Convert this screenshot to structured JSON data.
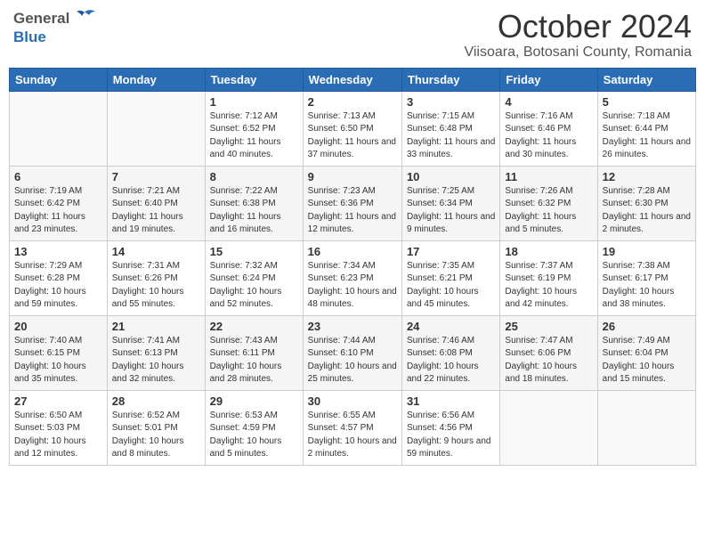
{
  "header": {
    "logo": {
      "general_text": "General",
      "blue_text": "Blue"
    },
    "month": "October 2024",
    "location": "Viisoara, Botosani County, Romania"
  },
  "weekdays": [
    "Sunday",
    "Monday",
    "Tuesday",
    "Wednesday",
    "Thursday",
    "Friday",
    "Saturday"
  ],
  "weeks": [
    [
      {
        "day": "",
        "info": ""
      },
      {
        "day": "",
        "info": ""
      },
      {
        "day": "1",
        "info": "Sunrise: 7:12 AM\nSunset: 6:52 PM\nDaylight: 11 hours and 40 minutes."
      },
      {
        "day": "2",
        "info": "Sunrise: 7:13 AM\nSunset: 6:50 PM\nDaylight: 11 hours and 37 minutes."
      },
      {
        "day": "3",
        "info": "Sunrise: 7:15 AM\nSunset: 6:48 PM\nDaylight: 11 hours and 33 minutes."
      },
      {
        "day": "4",
        "info": "Sunrise: 7:16 AM\nSunset: 6:46 PM\nDaylight: 11 hours and 30 minutes."
      },
      {
        "day": "5",
        "info": "Sunrise: 7:18 AM\nSunset: 6:44 PM\nDaylight: 11 hours and 26 minutes."
      }
    ],
    [
      {
        "day": "6",
        "info": "Sunrise: 7:19 AM\nSunset: 6:42 PM\nDaylight: 11 hours and 23 minutes."
      },
      {
        "day": "7",
        "info": "Sunrise: 7:21 AM\nSunset: 6:40 PM\nDaylight: 11 hours and 19 minutes."
      },
      {
        "day": "8",
        "info": "Sunrise: 7:22 AM\nSunset: 6:38 PM\nDaylight: 11 hours and 16 minutes."
      },
      {
        "day": "9",
        "info": "Sunrise: 7:23 AM\nSunset: 6:36 PM\nDaylight: 11 hours and 12 minutes."
      },
      {
        "day": "10",
        "info": "Sunrise: 7:25 AM\nSunset: 6:34 PM\nDaylight: 11 hours and 9 minutes."
      },
      {
        "day": "11",
        "info": "Sunrise: 7:26 AM\nSunset: 6:32 PM\nDaylight: 11 hours and 5 minutes."
      },
      {
        "day": "12",
        "info": "Sunrise: 7:28 AM\nSunset: 6:30 PM\nDaylight: 11 hours and 2 minutes."
      }
    ],
    [
      {
        "day": "13",
        "info": "Sunrise: 7:29 AM\nSunset: 6:28 PM\nDaylight: 10 hours and 59 minutes."
      },
      {
        "day": "14",
        "info": "Sunrise: 7:31 AM\nSunset: 6:26 PM\nDaylight: 10 hours and 55 minutes."
      },
      {
        "day": "15",
        "info": "Sunrise: 7:32 AM\nSunset: 6:24 PM\nDaylight: 10 hours and 52 minutes."
      },
      {
        "day": "16",
        "info": "Sunrise: 7:34 AM\nSunset: 6:23 PM\nDaylight: 10 hours and 48 minutes."
      },
      {
        "day": "17",
        "info": "Sunrise: 7:35 AM\nSunset: 6:21 PM\nDaylight: 10 hours and 45 minutes."
      },
      {
        "day": "18",
        "info": "Sunrise: 7:37 AM\nSunset: 6:19 PM\nDaylight: 10 hours and 42 minutes."
      },
      {
        "day": "19",
        "info": "Sunrise: 7:38 AM\nSunset: 6:17 PM\nDaylight: 10 hours and 38 minutes."
      }
    ],
    [
      {
        "day": "20",
        "info": "Sunrise: 7:40 AM\nSunset: 6:15 PM\nDaylight: 10 hours and 35 minutes."
      },
      {
        "day": "21",
        "info": "Sunrise: 7:41 AM\nSunset: 6:13 PM\nDaylight: 10 hours and 32 minutes."
      },
      {
        "day": "22",
        "info": "Sunrise: 7:43 AM\nSunset: 6:11 PM\nDaylight: 10 hours and 28 minutes."
      },
      {
        "day": "23",
        "info": "Sunrise: 7:44 AM\nSunset: 6:10 PM\nDaylight: 10 hours and 25 minutes."
      },
      {
        "day": "24",
        "info": "Sunrise: 7:46 AM\nSunset: 6:08 PM\nDaylight: 10 hours and 22 minutes."
      },
      {
        "day": "25",
        "info": "Sunrise: 7:47 AM\nSunset: 6:06 PM\nDaylight: 10 hours and 18 minutes."
      },
      {
        "day": "26",
        "info": "Sunrise: 7:49 AM\nSunset: 6:04 PM\nDaylight: 10 hours and 15 minutes."
      }
    ],
    [
      {
        "day": "27",
        "info": "Sunrise: 6:50 AM\nSunset: 5:03 PM\nDaylight: 10 hours and 12 minutes."
      },
      {
        "day": "28",
        "info": "Sunrise: 6:52 AM\nSunset: 5:01 PM\nDaylight: 10 hours and 8 minutes."
      },
      {
        "day": "29",
        "info": "Sunrise: 6:53 AM\nSunset: 4:59 PM\nDaylight: 10 hours and 5 minutes."
      },
      {
        "day": "30",
        "info": "Sunrise: 6:55 AM\nSunset: 4:57 PM\nDaylight: 10 hours and 2 minutes."
      },
      {
        "day": "31",
        "info": "Sunrise: 6:56 AM\nSunset: 4:56 PM\nDaylight: 9 hours and 59 minutes."
      },
      {
        "day": "",
        "info": ""
      },
      {
        "day": "",
        "info": ""
      }
    ]
  ]
}
